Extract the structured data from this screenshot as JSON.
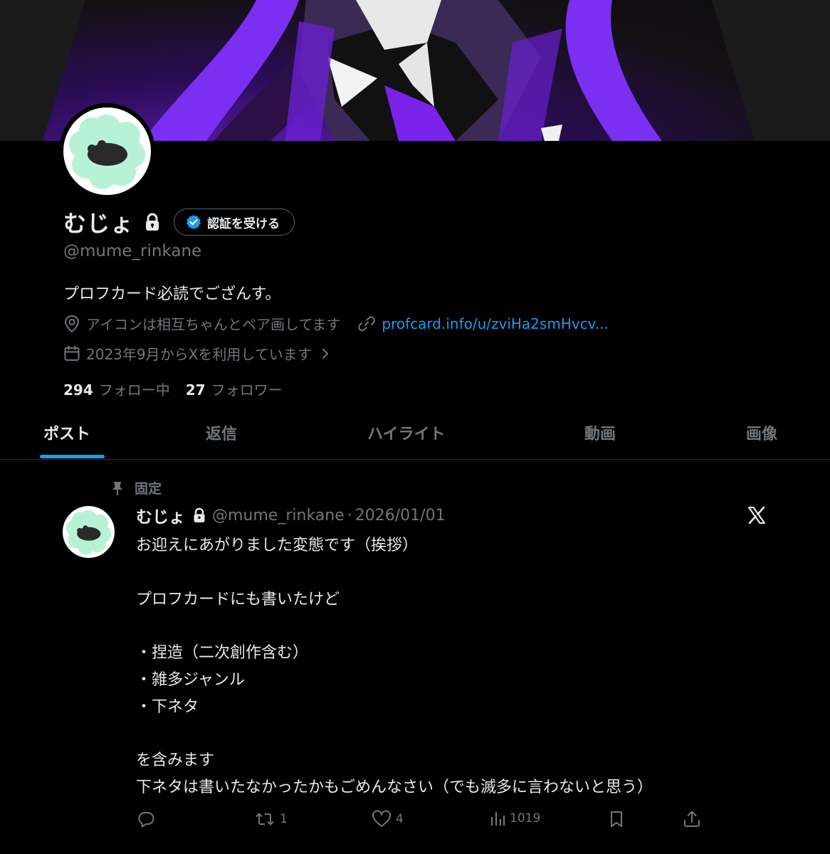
{
  "profile": {
    "display_name": "むじょ",
    "verify_label": "認証を受ける",
    "handle": "@mume_rinkane",
    "bio": "プロフカード必読でござんす。",
    "location": "アイコンは相互ちゃんとペア画してます",
    "url": "profcard.info/u/zviHa2smHvcv...",
    "joined": "2023年9月からXを利用しています",
    "following_count": "294",
    "following_label": "フォロー中",
    "followers_count": "27",
    "followers_label": "フォロワー"
  },
  "tabs": [
    {
      "label": "ポスト",
      "active": true
    },
    {
      "label": "返信",
      "active": false
    },
    {
      "label": "ハイライト",
      "active": false
    },
    {
      "label": "動画",
      "active": false
    },
    {
      "label": "画像",
      "active": false
    }
  ],
  "post": {
    "pinned_label": "固定",
    "author_name": "むじょ",
    "author_handle": "@mume_rinkane",
    "separator": "·",
    "date": "2026/01/01",
    "lines": [
      "お迎えにあがりました変態です（挨拶）",
      "",
      "プロフカードにも書いたけど",
      "",
      "・捏造（二次創作含む）",
      "・雑多ジャンル",
      "・下ネタ",
      "",
      "を含みます",
      "下ネタは書いたなかったかもごめんなさい（でも滅多に言わないと思う）"
    ],
    "retweets": "1",
    "likes": "4",
    "views": "1019"
  },
  "colors": {
    "accent": "#1d9bf0",
    "muted": "#71767b",
    "text": "#e7e9ea",
    "background": "#000000",
    "avatar_ring": "#a8f0d0"
  }
}
